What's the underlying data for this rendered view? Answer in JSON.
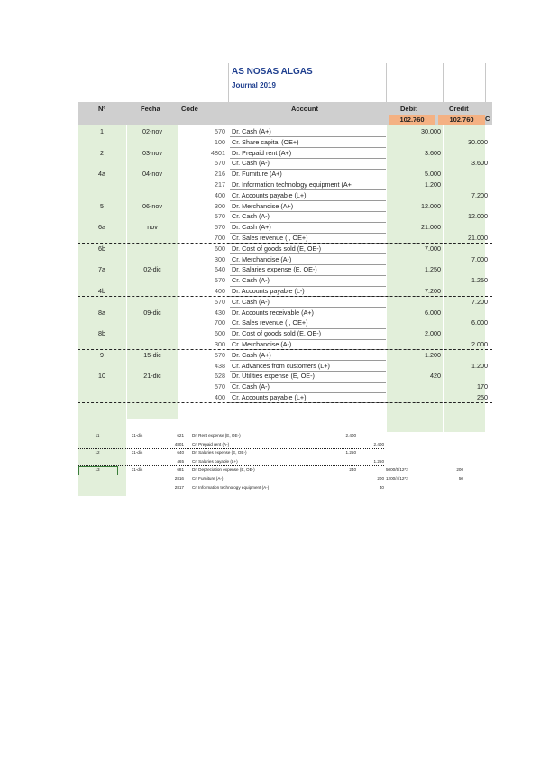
{
  "sheet": {
    "title": "AS NOSAS ALGAS",
    "subtitle": "Journal 2019",
    "headers": {
      "no": "Nº",
      "date": "Fecha",
      "code": "Code",
      "account": "Account",
      "debit": "Debit",
      "credit": "Credit"
    },
    "totals": {
      "debit": "102.760",
      "credit": "102.760",
      "extra": "C"
    },
    "colors": {
      "band": "#cfcfcf",
      "column_fill": "#e2efda",
      "totals_fill": "#f4b183",
      "title": "#1f3f8f"
    }
  },
  "rows": [
    {
      "no": "1",
      "date": "02-nov",
      "code": "570",
      "account": "Dr. Cash (A+)",
      "debit": "30.000",
      "credit": ""
    },
    {
      "no": "",
      "date": "",
      "code": "100",
      "account": "Cr. Share capital (OE+)",
      "debit": "",
      "credit": "30.000"
    },
    {
      "no": "2",
      "date": "03-nov",
      "code": "4801",
      "account": "Dr. Prepaid rent (A+)",
      "debit": "3.600",
      "credit": ""
    },
    {
      "no": "",
      "date": "",
      "code": "570",
      "account": "Cr. Cash (A-)",
      "debit": "",
      "credit": "3.600"
    },
    {
      "no": "4a",
      "date": "04-nov",
      "code": "216",
      "account": "Dr. Furniture (A+)",
      "debit": "5.000",
      "credit": ""
    },
    {
      "no": "",
      "date": "",
      "code": "217",
      "account": "Dr. Information technology equipment (A+",
      "debit": "1.200",
      "credit": ""
    },
    {
      "no": "",
      "date": "",
      "code": "400",
      "account": "Cr. Accounts payable (L+)",
      "debit": "",
      "credit": "7.200"
    },
    {
      "no": "5",
      "date": "06-nov",
      "code": "300",
      "account": "Dr. Merchandise (A+)",
      "debit": "12.000",
      "credit": ""
    },
    {
      "no": "",
      "date": "",
      "code": "570",
      "account": "Cr. Cash (A-)",
      "debit": "",
      "credit": "12.000"
    },
    {
      "no": "6a",
      "date": "nov",
      "code": "570",
      "account": "Dr. Cash (A+)",
      "debit": "21.000",
      "credit": ""
    },
    {
      "no": "",
      "date": "",
      "code": "700",
      "account": "Cr. Sales revenue (I, OE+)",
      "debit": "",
      "credit": "21.000"
    },
    {
      "no": "6b",
      "date": "",
      "code": "600",
      "account": "Dr. Cost of goods sold (E, OE-)",
      "debit": "7.000",
      "credit": ""
    },
    {
      "no": "",
      "date": "",
      "code": "300",
      "account": "Cr. Merchandise (A-)",
      "debit": "",
      "credit": "7.000"
    },
    {
      "no": "7a",
      "date": "02-dic",
      "code": "640",
      "account": "Dr. Salaries expense (E, OE-)",
      "debit": "1.250",
      "credit": ""
    },
    {
      "no": "",
      "date": "",
      "code": "570",
      "account": "Cr. Cash (A-)",
      "debit": "",
      "credit": "1.250"
    },
    {
      "no": "4b",
      "date": "",
      "code": "400",
      "account": "Dr. Accounts payable (L-)",
      "debit": "7.200",
      "credit": ""
    },
    {
      "no": "",
      "date": "",
      "code": "570",
      "account": "Cr. Cash (A-)",
      "debit": "",
      "credit": "7.200"
    },
    {
      "no": "8a",
      "date": "09-dic",
      "code": "430",
      "account": "Dr. Accounts receivable (A+)",
      "debit": "6.000",
      "credit": ""
    },
    {
      "no": "",
      "date": "",
      "code": "700",
      "account": "Cr. Sales revenue (I, OE+)",
      "debit": "",
      "credit": "6.000"
    },
    {
      "no": "8b",
      "date": "",
      "code": "600",
      "account": "Dr. Cost of goods sold (E, OE-)",
      "debit": "2.000",
      "credit": ""
    },
    {
      "no": "",
      "date": "",
      "code": "300",
      "account": "Cr. Merchandise (A-)",
      "debit": "",
      "credit": "2.000"
    },
    {
      "no": "9",
      "date": "15-dic",
      "code": "570",
      "account": "Dr. Cash (A+)",
      "debit": "1.200",
      "credit": ""
    },
    {
      "no": "",
      "date": "",
      "code": "438",
      "account": "Cr. Advances from customers (L+)",
      "debit": "",
      "credit": "1.200"
    },
    {
      "no": "10",
      "date": "21-dic",
      "code": "628",
      "account": "Dr. Utilities expense (E, OE-)",
      "debit": "420",
      "credit": ""
    },
    {
      "no": "",
      "date": "",
      "code": "570",
      "account": "Cr. Cash (A-)",
      "debit": "",
      "credit": "170"
    },
    {
      "no": "",
      "date": "",
      "code": "400",
      "account": "Cr. Accounts payable (L+)",
      "debit": "",
      "credit": "250"
    }
  ],
  "small_rows": [
    {
      "no": "11",
      "date": "31-dic",
      "code": "621",
      "account": "Dr. Rent expense (E, OE-)",
      "debit": "2.400",
      "credit": "",
      "note": "",
      "extra": ""
    },
    {
      "no": "",
      "date": "",
      "code": "4801",
      "account": "Cr. Prepaid rent (A-)",
      "debit": "",
      "credit": "2.400",
      "note": "",
      "extra": ""
    },
    {
      "no": "12",
      "date": "31-dic",
      "code": "640",
      "account": "Dr. Salaries expense (E, OE-)",
      "debit": "1.250",
      "credit": "",
      "note": "",
      "extra": ""
    },
    {
      "no": "",
      "date": "",
      "code": "465",
      "account": "Cr. Salaries payable (L+)",
      "debit": "",
      "credit": "1.250",
      "note": "",
      "extra": ""
    },
    {
      "no": "13",
      "date": "31-dic",
      "code": "681",
      "account": "Dr. Depreciation expense (E, OE-)",
      "debit": "240",
      "credit": "",
      "note": "5000/5/12*2",
      "extra": "200"
    },
    {
      "no": "",
      "date": "",
      "code": "2816",
      "account": "Cr. Furniture (A-)",
      "debit": "",
      "credit": "200",
      "note": "1200/4/12*2",
      "extra": "50"
    },
    {
      "no": "",
      "date": "",
      "code": "2817",
      "account": "Cr. Information technology equipment (A-)",
      "debit": "",
      "credit": "40",
      "note": "",
      "extra": ""
    }
  ]
}
